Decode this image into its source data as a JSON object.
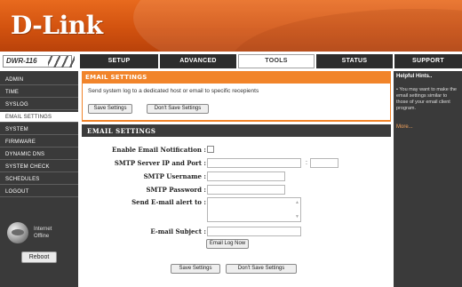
{
  "brand": {
    "logo": "D-Link",
    "model": "DWR-116"
  },
  "tabs": [
    {
      "label": "SETUP"
    },
    {
      "label": "ADVANCED"
    },
    {
      "label": "TOOLS"
    },
    {
      "label": "STATUS"
    },
    {
      "label": "SUPPORT"
    }
  ],
  "active_tab": "TOOLS",
  "sidebar": {
    "items": [
      {
        "label": "ADMIN"
      },
      {
        "label": "TIME"
      },
      {
        "label": "SYSLOG"
      },
      {
        "label": "EMAIL SETTINGS"
      },
      {
        "label": "SYSTEM"
      },
      {
        "label": "FIRMWARE"
      },
      {
        "label": "DYNAMIC DNS"
      },
      {
        "label": "SYSTEM CHECK"
      },
      {
        "label": "SCHEDULES"
      },
      {
        "label": "LOGOUT"
      }
    ],
    "active_item": "EMAIL SETTINGS",
    "status_line1": "Internet",
    "status_line2": "Offline",
    "reboot_label": "Reboot"
  },
  "email_section": {
    "title": "EMAIL SETTINGS",
    "description": "Send system log to a dedicated host or email to specific recepients",
    "save_label": "Save Settings",
    "dont_save_label": "Don't Save Settings"
  },
  "email_form": {
    "title": "EMAIL SETTINGS",
    "enable_label": "Enable Email Notification :",
    "enable_checked": false,
    "smtp_server_label": "SMTP Server IP and Port :",
    "smtp_server_value": "",
    "smtp_port_value": "",
    "smtp_username_label": "SMTP Username :",
    "smtp_username_value": "",
    "smtp_password_label": "SMTP Password :",
    "smtp_password_value": "",
    "send_to_label": "Send E-mail alert to :",
    "send_to_value": "",
    "subject_label": "E-mail Subject :",
    "subject_value": "",
    "email_log_now_label": "Email Log Now",
    "colon": ":"
  },
  "bottom_buttons": {
    "save_label": "Save Settings",
    "dont_save_label": "Don't Save Settings"
  },
  "hints": {
    "title": "Helpful Hints..",
    "text": "• You may want to make the email settings similar to those of your email client program.",
    "more": "More..."
  },
  "colors": {
    "header_orange": "#d2520f",
    "section_orange": "#f1842a",
    "dark_panel": "#3a3a3a",
    "hint_link": "#f2a25c"
  }
}
